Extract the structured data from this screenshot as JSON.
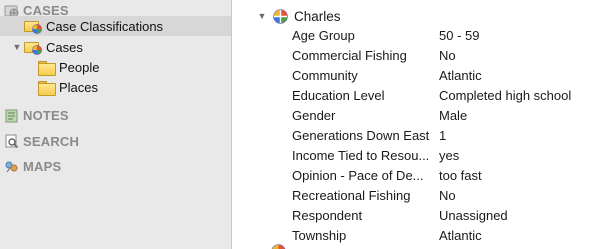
{
  "sidebar": {
    "sections": [
      {
        "label": "CASES",
        "icon": "cases-icon"
      },
      {
        "label": "NOTES",
        "icon": "notes-icon"
      },
      {
        "label": "SEARCH",
        "icon": "search-icon"
      },
      {
        "label": "MAPS",
        "icon": "maps-icon"
      }
    ],
    "items": [
      {
        "label": "Case Classifications"
      },
      {
        "label": "Cases"
      },
      {
        "label": "People"
      },
      {
        "label": "Places"
      }
    ]
  },
  "main": {
    "case_name": "Charles",
    "attributes": [
      {
        "name": "Age Group",
        "value": "50 - 59"
      },
      {
        "name": "Commercial Fishing",
        "value": "No"
      },
      {
        "name": "Community",
        "value": "Atlantic"
      },
      {
        "name": "Education Level",
        "value": "Completed high school"
      },
      {
        "name": "Gender",
        "value": "Male"
      },
      {
        "name": "Generations Down East",
        "value": "1"
      },
      {
        "name": "Income Tied to Resou...",
        "value": "yes"
      },
      {
        "name": "Opinion - Pace of De...",
        "value": "too fast"
      },
      {
        "name": "Recreational Fishing",
        "value": "No"
      },
      {
        "name": "Respondent",
        "value": "Unassigned"
      },
      {
        "name": "Township",
        "value": "Atlantic"
      }
    ]
  }
}
